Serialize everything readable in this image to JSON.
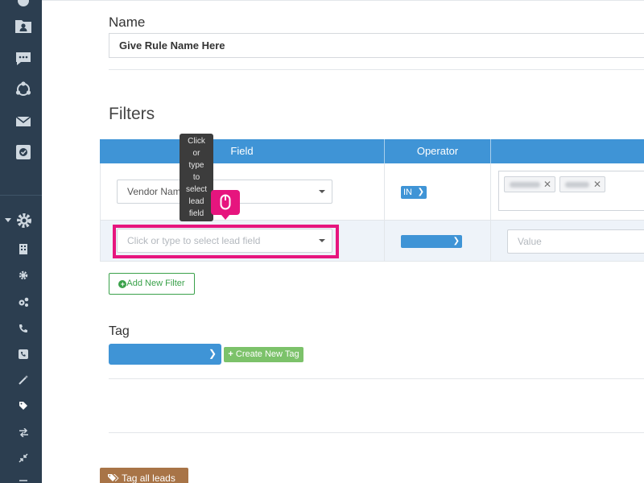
{
  "sidebar": {
    "top_icons": [
      "contacts-folder-icon",
      "chat-bubble-icon",
      "network-share-icon",
      "envelope-icon",
      "clipboard-check-icon"
    ],
    "settings_icon": "gear-icon",
    "sub_icons": [
      "building-icon",
      "gear-small-icon",
      "gears-icon",
      "phone-icon",
      "phone-square-icon",
      "magic-wand-icon",
      "tag-icon",
      "exchange-icon",
      "compress-icon"
    ]
  },
  "form": {
    "name_label": "Name",
    "name_value": "Give Rule Name Here",
    "filters_label": "Filters",
    "table": {
      "headers": [
        "Field",
        "Operator",
        ""
      ],
      "rows": [
        {
          "field": "Vendor Nam",
          "operator": "IN",
          "values": [
            "",
            ""
          ]
        },
        {
          "field_placeholder": "Click or type to select lead field",
          "operator": "",
          "value_placeholder": "Value"
        }
      ]
    },
    "add_filter_label": "Add New Filter",
    "tag_label": "Tag",
    "tag_value": "",
    "create_tag_label": "Create New Tag",
    "tag_all_label": "Tag all leads"
  },
  "tooltip": {
    "words": [
      "Click",
      "or",
      "type",
      "to",
      "select",
      "lead",
      "field"
    ]
  },
  "colors": {
    "sidebar": "#2c3e50",
    "header_blue": "#3f94d6",
    "highlight_pink": "#e6157e",
    "green": "#3aa14a",
    "light_green": "#7cc26a",
    "brown": "#a87447"
  }
}
